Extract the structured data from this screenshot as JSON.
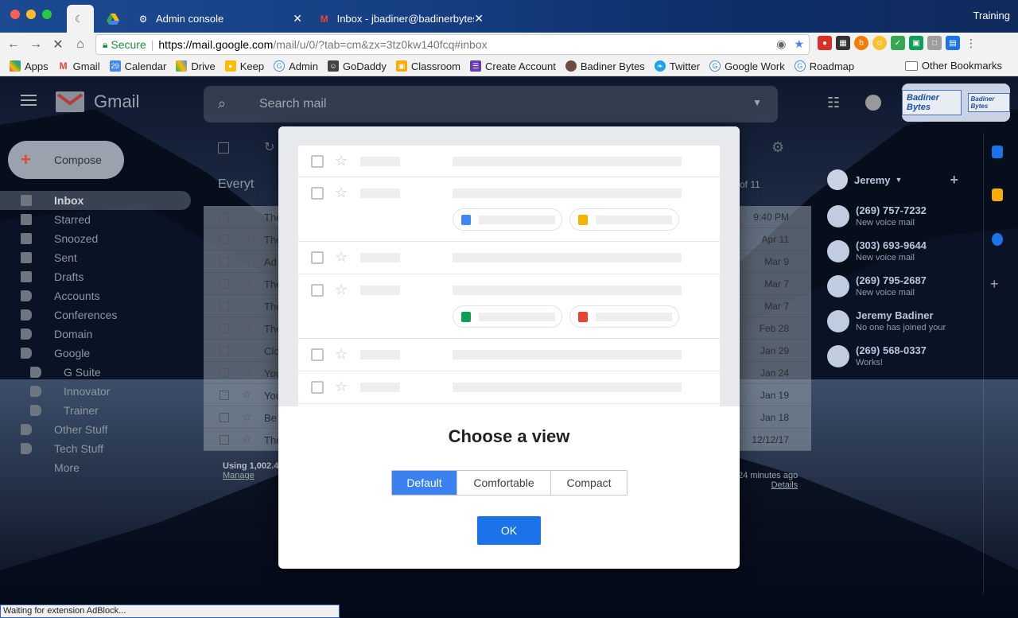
{
  "browser": {
    "tabs": [
      {
        "label": "",
        "active": true
      },
      {
        "label": "",
        "active": false
      },
      {
        "label": "Admin console",
        "active": false
      },
      {
        "label": "Inbox - jbadiner@badinerbytes",
        "active": false
      }
    ],
    "profile": "Training",
    "secure_label": "Secure",
    "url_host": "https://mail.google.com",
    "url_rest": "/mail/u/0/?tab=cm&zx=3tz0kw140fcq#inbox",
    "bookmarks": [
      "Apps",
      "Gmail",
      "Calendar",
      "Drive",
      "Keep",
      "Admin",
      "GoDaddy",
      "Classroom",
      "Create Account",
      "Badiner Bytes",
      "Twitter",
      "Google Work",
      "Roadmap"
    ],
    "other_bookmarks": "Other Bookmarks",
    "status": "Waiting for extension AdBlock..."
  },
  "gmail": {
    "logo_text": "Gmail",
    "search_placeholder": "Search mail",
    "brand": {
      "line1": "Badiner Bytes",
      "line2": "Badiner Bytes"
    },
    "compose_label": "Compose",
    "nav": [
      {
        "label": "Inbox",
        "active": true,
        "sub": false
      },
      {
        "label": "Starred",
        "sub": false
      },
      {
        "label": "Snoozed",
        "sub": false
      },
      {
        "label": "Sent",
        "sub": false
      },
      {
        "label": "Drafts",
        "sub": false
      },
      {
        "label": "Accounts",
        "sub": false
      },
      {
        "label": "Conferences",
        "sub": false
      },
      {
        "label": "Domain",
        "sub": false
      },
      {
        "label": "Google",
        "sub": false
      },
      {
        "label": "G Suite",
        "sub": true
      },
      {
        "label": "Innovator",
        "sub": true
      },
      {
        "label": "Trainer",
        "sub": true
      },
      {
        "label": "Other Stuff",
        "sub": false
      },
      {
        "label": "Tech Stuff",
        "sub": false
      },
      {
        "label": "More",
        "sub": false
      }
    ],
    "everything_label": "Everyt",
    "page_count": "of 11",
    "emails": [
      {
        "sender": "The",
        "date": "9:40 PM"
      },
      {
        "sender": "The",
        "date": "Apr 11"
      },
      {
        "sender": "Ad",
        "date": "Mar 9"
      },
      {
        "sender": "The",
        "date": "Mar 7"
      },
      {
        "sender": "The",
        "date": "Mar 7"
      },
      {
        "sender": "The",
        "date": "Feb 28"
      },
      {
        "sender": "Clo",
        "date": "Jan 29"
      },
      {
        "sender": "You",
        "date": "Jan 24"
      },
      {
        "sender": "You",
        "date": "Jan 19"
      },
      {
        "sender": "Be",
        "date": "Jan 18"
      },
      {
        "sender": "The",
        "date": "12/12/17"
      }
    ],
    "storage_text": "Using 1,002.4",
    "manage_label": "Manage",
    "activity_text": "24 minutes ago",
    "details_label": "Details",
    "chat_user": "Jeremy",
    "contacts": [
      {
        "name": "(269) 757-7232",
        "sub": "New voice mail"
      },
      {
        "name": "(303) 693-9644",
        "sub": "New voice mail"
      },
      {
        "name": "(269) 795-2687",
        "sub": "New voice mail"
      },
      {
        "name": "Jeremy Badiner",
        "sub": "No one has joined your"
      },
      {
        "name": "(269) 568-0337",
        "sub": "Works!"
      }
    ]
  },
  "modal": {
    "title": "Choose a view",
    "options": [
      "Default",
      "Comfortable",
      "Compact"
    ],
    "selected": "Default",
    "ok_label": "OK"
  }
}
